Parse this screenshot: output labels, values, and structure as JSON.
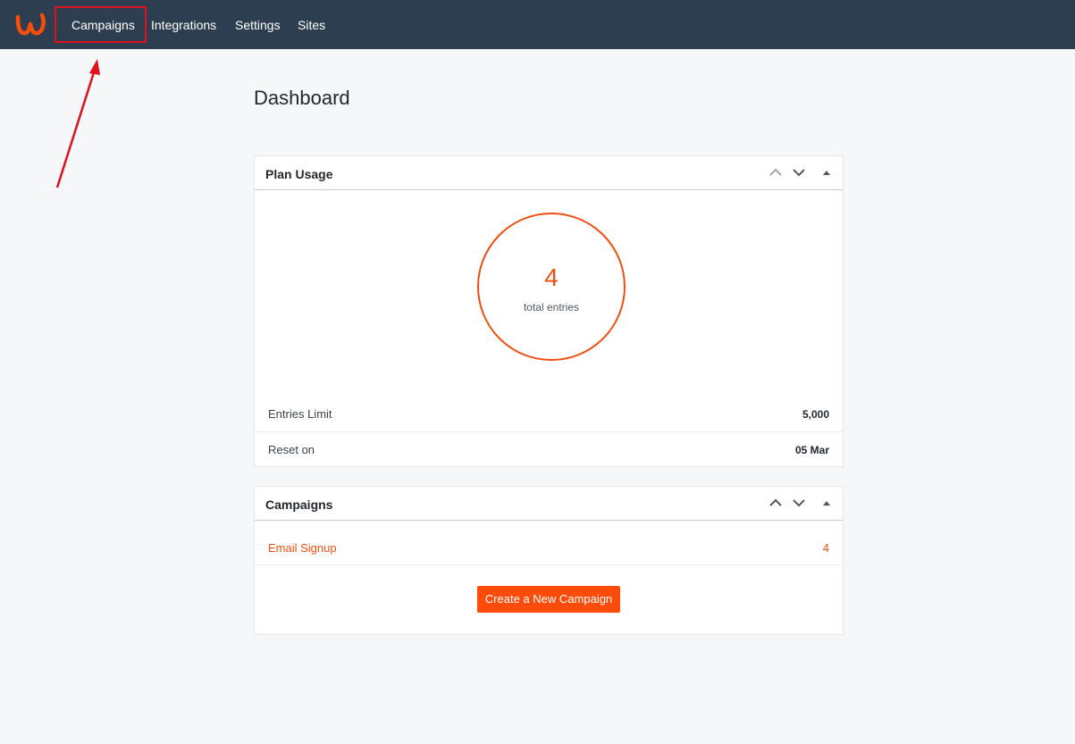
{
  "nav": {
    "logo_icon": "w-brand-logo-icon",
    "items": [
      {
        "label": "Campaigns"
      },
      {
        "label": "Integrations"
      },
      {
        "label": "Settings"
      },
      {
        "label": "Sites"
      }
    ]
  },
  "page": {
    "title": "Dashboard"
  },
  "plan_usage": {
    "title": "Plan Usage",
    "total_entries": "4",
    "total_entries_label": "total entries",
    "rows": [
      {
        "label": "Entries Limit",
        "value": "5,000"
      },
      {
        "label": "Reset on",
        "value": "05 Mar"
      }
    ]
  },
  "campaigns": {
    "title": "Campaigns",
    "items": [
      {
        "name": "Email Signup",
        "count": "4"
      }
    ],
    "create_button": "Create a New Campaign"
  },
  "colors": {
    "topbar": "#2c3e50",
    "accent": "#f04e10",
    "button": "#fd4c09",
    "annotation": "#e0101d"
  }
}
